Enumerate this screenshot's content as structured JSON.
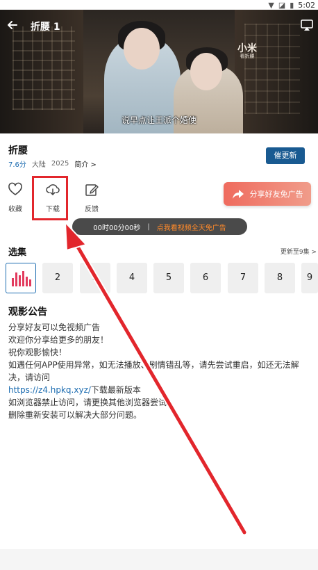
{
  "status": {
    "time": "5:02"
  },
  "player": {
    "title": "折腰 1",
    "subtitle": "说早点让王派个婚使",
    "watermark": "小米",
    "watermark_small": "看折腰"
  },
  "show": {
    "title": "折腰",
    "score": "7.6分",
    "region": "大陆",
    "year": "2025",
    "intro_label": "简介 >",
    "remind_label": "催更新"
  },
  "actions": {
    "favorite": "收藏",
    "download": "下载",
    "feedback": "反馈",
    "share": "分享好友免广告"
  },
  "ad_bar": {
    "timer": "00时00分00秒",
    "separator": "|",
    "link": "点我看视频全天免广告"
  },
  "episodes": {
    "title": "选集",
    "more": "更新至9集 >",
    "items": [
      "2",
      "3",
      "4",
      "5",
      "6",
      "7",
      "8",
      "9"
    ]
  },
  "notice": {
    "title": "观影公告",
    "line1": "分享好友可以免视频广告",
    "line2": "欢迎你分享给更多的朋友！",
    "line3": "祝你观影愉快！",
    "line4": "如遇任何APP使用异常，如无法播放、剧情错乱等，请先尝试重启，如还无法解决，请访问",
    "link": "https://z4.hpkq.xyz/",
    "line5_suffix": "下载最新版本",
    "line6": "如浏览器禁止访问，请更换其他浏览器尝试。",
    "line7": "删除重新安装可以解决大部分问题。"
  },
  "colors": {
    "accent": "#195a91",
    "highlight": "#e2262c",
    "ad_link": "#ff8a2a",
    "share_gradient_start": "#ef6b5e"
  }
}
